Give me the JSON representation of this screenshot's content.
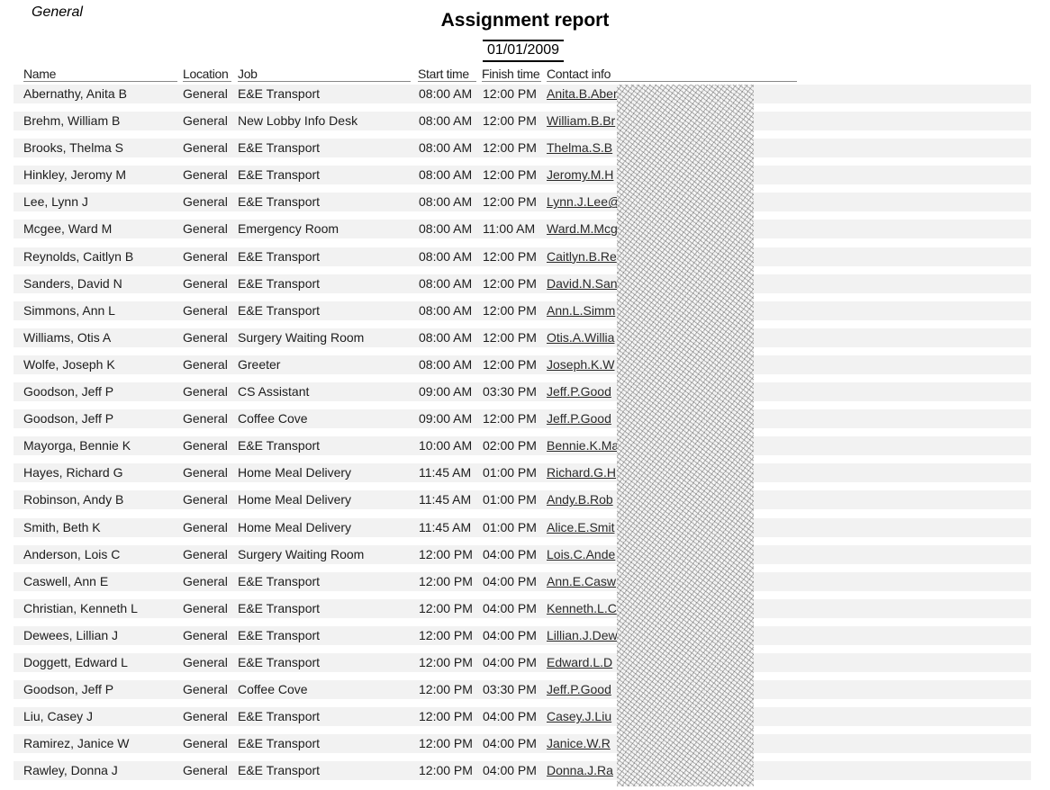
{
  "section": "General",
  "title": "Assignment report",
  "date": "01/01/2009",
  "columns": {
    "name": "Name",
    "location": "Location",
    "job": "Job",
    "start": "Start time",
    "finish": "Finish time",
    "contact": "Contact info"
  },
  "rows": [
    {
      "name": "Abernathy, Anita B",
      "location": "General",
      "job": "E&E Transport",
      "start": "08:00 AM",
      "finish": "12:00 PM",
      "contact": "Anita.B.Aber"
    },
    {
      "name": "Brehm, William B",
      "location": "General",
      "job": "New Lobby Info Desk",
      "start": "08:00 AM",
      "finish": "12:00 PM",
      "contact": "William.B.Br"
    },
    {
      "name": "Brooks, Thelma S",
      "location": "General",
      "job": "E&E Transport",
      "start": "08:00 AM",
      "finish": "12:00 PM",
      "contact": "Thelma.S.B"
    },
    {
      "name": "Hinkley, Jeromy M",
      "location": "General",
      "job": "E&E Transport",
      "start": "08:00 AM",
      "finish": "12:00 PM",
      "contact": "Jeromy.M.H"
    },
    {
      "name": "Lee, Lynn J",
      "location": "General",
      "job": "E&E Transport",
      "start": "08:00 AM",
      "finish": "12:00 PM",
      "contact": "Lynn.J.Lee@"
    },
    {
      "name": "Mcgee, Ward M",
      "location": "General",
      "job": "Emergency Room",
      "start": "08:00 AM",
      "finish": "11:00 AM",
      "contact": "Ward.M.Mcg"
    },
    {
      "name": "Reynolds, Caitlyn B",
      "location": "General",
      "job": "E&E Transport",
      "start": "08:00 AM",
      "finish": "12:00 PM",
      "contact": "Caitlyn.B.Re"
    },
    {
      "name": "Sanders, David N",
      "location": "General",
      "job": "E&E Transport",
      "start": "08:00 AM",
      "finish": "12:00 PM",
      "contact": "David.N.San"
    },
    {
      "name": "Simmons, Ann L",
      "location": "General",
      "job": "E&E Transport",
      "start": "08:00 AM",
      "finish": "12:00 PM",
      "contact": "Ann.L.Simm"
    },
    {
      "name": "Williams, Otis A",
      "location": "General",
      "job": "Surgery Waiting Room",
      "start": "08:00 AM",
      "finish": "12:00 PM",
      "contact": "Otis.A.Willia"
    },
    {
      "name": "Wolfe, Joseph K",
      "location": "General",
      "job": "Greeter",
      "start": "08:00 AM",
      "finish": "12:00 PM",
      "contact": "Joseph.K.W"
    },
    {
      "name": "Goodson, Jeff P",
      "location": "General",
      "job": "CS Assistant",
      "start": "09:00 AM",
      "finish": "03:30 PM",
      "contact": "Jeff.P.Good"
    },
    {
      "name": "Goodson, Jeff P",
      "location": "General",
      "job": "Coffee Cove",
      "start": "09:00 AM",
      "finish": "12:00 PM",
      "contact": "Jeff.P.Good"
    },
    {
      "name": "Mayorga, Bennie K",
      "location": "General",
      "job": "E&E Transport",
      "start": "10:00 AM",
      "finish": "02:00 PM",
      "contact": "Bennie.K.Ma"
    },
    {
      "name": "Hayes, Richard G",
      "location": "General",
      "job": "Home Meal Delivery",
      "start": "11:45 AM",
      "finish": "01:00 PM",
      "contact": "Richard.G.H"
    },
    {
      "name": "Robinson, Andy B",
      "location": "General",
      "job": "Home Meal Delivery",
      "start": "11:45 AM",
      "finish": "01:00 PM",
      "contact": "Andy.B.Rob"
    },
    {
      "name": "Smith, Beth K",
      "location": "General",
      "job": "Home Meal Delivery",
      "start": "11:45 AM",
      "finish": "01:00 PM",
      "contact": "Alice.E.Smit"
    },
    {
      "name": "Anderson, Lois C",
      "location": "General",
      "job": "Surgery Waiting Room",
      "start": "12:00 PM",
      "finish": "04:00 PM",
      "contact": "Lois.C.Ande"
    },
    {
      "name": "Caswell, Ann E",
      "location": "General",
      "job": "E&E Transport",
      "start": "12:00 PM",
      "finish": "04:00 PM",
      "contact": "Ann.E.Casw"
    },
    {
      "name": "Christian, Kenneth L",
      "location": "General",
      "job": "E&E Transport",
      "start": "12:00 PM",
      "finish": "04:00 PM",
      "contact": "Kenneth.L.C"
    },
    {
      "name": "Dewees, Lillian J",
      "location": "General",
      "job": "E&E Transport",
      "start": "12:00 PM",
      "finish": "04:00 PM",
      "contact": "Lillian.J.Dew"
    },
    {
      "name": "Doggett, Edward L",
      "location": "General",
      "job": "E&E Transport",
      "start": "12:00 PM",
      "finish": "04:00 PM",
      "contact": "Edward.L.D"
    },
    {
      "name": "Goodson, Jeff P",
      "location": "General",
      "job": "Coffee Cove",
      "start": "12:00 PM",
      "finish": "03:30 PM",
      "contact": "Jeff.P.Good"
    },
    {
      "name": "Liu, Casey J",
      "location": "General",
      "job": "E&E Transport",
      "start": "12:00 PM",
      "finish": "04:00 PM",
      "contact": "Casey.J.Liu"
    },
    {
      "name": "Ramirez, Janice W",
      "location": "General",
      "job": "E&E Transport",
      "start": "12:00 PM",
      "finish": "04:00 PM",
      "contact": "Janice.W.R"
    },
    {
      "name": "Rawley, Donna J",
      "location": "General",
      "job": "E&E Transport",
      "start": "12:00 PM",
      "finish": "04:00 PM",
      "contact": "Donna.J.Ra"
    }
  ]
}
